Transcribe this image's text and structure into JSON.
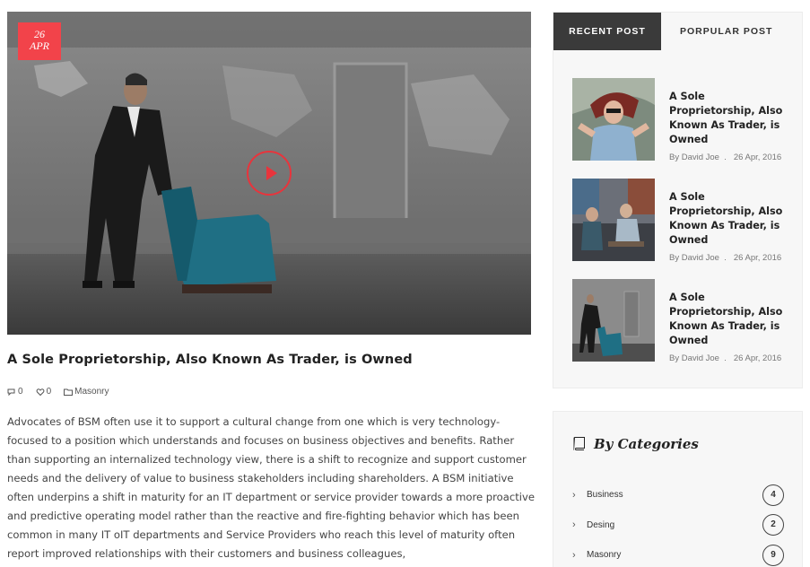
{
  "post": {
    "date_day": "26",
    "date_month": "APR",
    "title": "A Sole Proprietorship, Also Known As Trader, is Owned",
    "comments_count": "0",
    "likes_count": "0",
    "category": "Masonry",
    "body": "Advocates of BSM often use it to support a cultural change from one which is very technology-focused to a position which understands and focuses on business objectives and benefits. Rather than supporting an internalized technology view, there is a shift to recognize and support customer needs and the delivery of value to business stakeholders including shareholders. A BSM initiative often underpins a shift in maturity for an IT department or service provider towards a more proactive and predictive operating model rather than the reactive and fire-fighting behavior which has been common in many IT oIT departments and Service Providers who reach this level of maturity often report improved relationships with their customers and business colleagues,"
  },
  "sidebar": {
    "tabs": [
      {
        "label": "RECENT POST",
        "active": true
      },
      {
        "label": "PORPULAR POST",
        "active": false
      }
    ],
    "recent_posts": [
      {
        "title": "A Sole Proprietorship, Also Known As Trader, is Owned",
        "author": "By David Joe",
        "date": "26 Apr, 2016"
      },
      {
        "title": "A Sole Proprietorship, Also Known As Trader, is Owned",
        "author": "By David Joe",
        "date": "26 Apr, 2016"
      },
      {
        "title": "A Sole Proprietorship, Also Known As Trader, is Owned",
        "author": "By David Joe",
        "date": "26 Apr, 2016"
      }
    ],
    "categories_heading": "By Categories",
    "categories": [
      {
        "name": "Business",
        "count": "4"
      },
      {
        "name": "Desing",
        "count": "2"
      },
      {
        "name": "Masonry",
        "count": "9"
      }
    ]
  },
  "colors": {
    "accent": "#f2434a",
    "dark_tab": "#3a3a3a"
  },
  "icons": {
    "date_badge": "date-badge",
    "play": "play-icon",
    "comments": "comment-icon",
    "likes": "heart-icon",
    "category": "folder-icon",
    "categories_heading": "book-icon",
    "category_row": "chevron-right-icon"
  }
}
